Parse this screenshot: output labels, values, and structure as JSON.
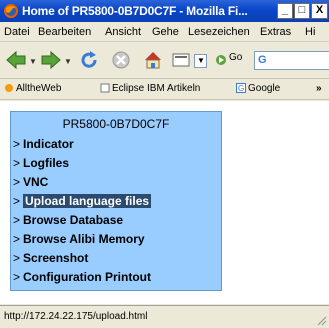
{
  "window": {
    "title": "Home of PR5800-0B7D0C7F - Mozilla Fi...",
    "minimize": "_",
    "maximize": "□",
    "close": "X"
  },
  "menubar": [
    "Datei",
    "Bearbeiten",
    "Ansicht",
    "Gehe",
    "Lesezeichen",
    "Extras",
    "Hi"
  ],
  "navbar": {
    "go_label": "Go",
    "url_value": "G"
  },
  "bookmarks": [
    "AlltheWeb",
    "Eclipse IBM Artikeln",
    "Google"
  ],
  "page": {
    "panel_title": "PR5800-0B7D0C7F",
    "links": [
      {
        "arrow": ">",
        "text": "Indicator"
      },
      {
        "arrow": ">",
        "text": "Logfiles"
      },
      {
        "arrow": ">",
        "text": "VNC"
      },
      {
        "arrow": ">",
        "text": "Upload language files"
      },
      {
        "arrow": ">",
        "text": "Browse Database"
      },
      {
        "arrow": ">",
        "text": "Browse Alibi Memory"
      },
      {
        "arrow": ">",
        "text": "Screenshot"
      },
      {
        "arrow": ">",
        "text": "Configuration Printout"
      }
    ]
  },
  "status": {
    "text": "http://172.24.22.175/upload.html"
  },
  "icons": {
    "back": "back-arrow-icon",
    "forward": "forward-arrow-icon",
    "reload": "reload-icon",
    "stop": "stop-icon",
    "home": "home-icon",
    "page": "page-icon",
    "go": "go-icon"
  },
  "colors": {
    "titlebar": "#0a46c9",
    "panel": "#99ccff",
    "active_link_bg": "#2a4a6e"
  }
}
